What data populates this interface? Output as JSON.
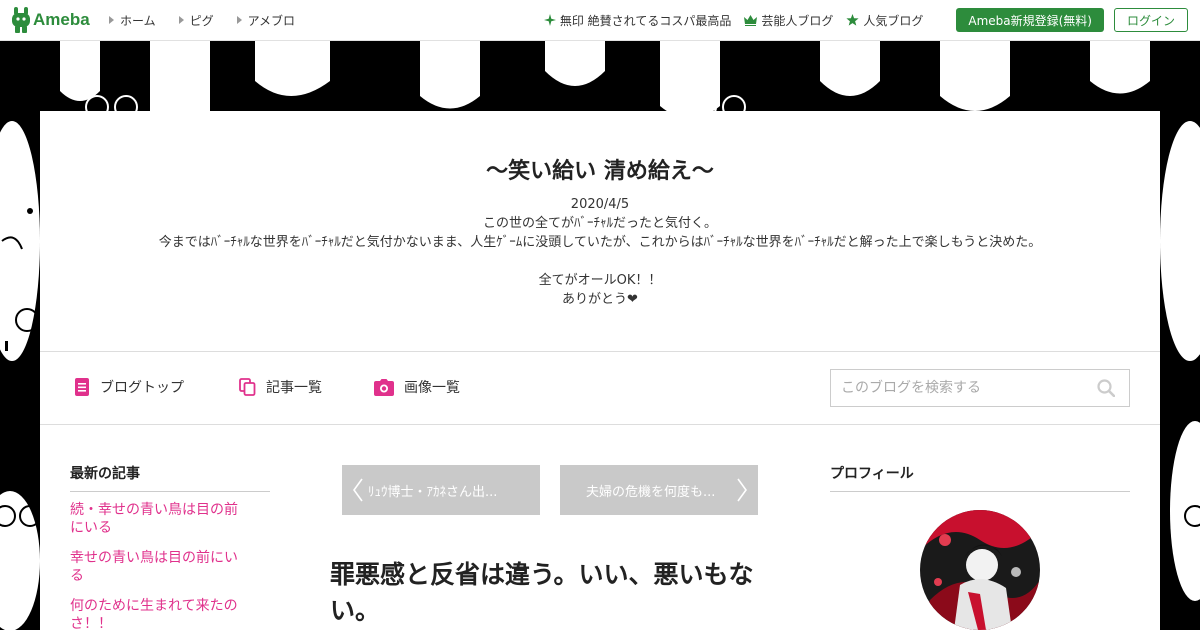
{
  "topbar": {
    "logo_text": "Ameba",
    "nav": [
      {
        "label": "ホーム"
      },
      {
        "label": "ピグ"
      },
      {
        "label": "アメブロ"
      }
    ],
    "promos": [
      {
        "label": "無印 絶賛されてるコスパ最高品",
        "icon": "sparkle-icon"
      },
      {
        "label": "芸能人ブログ",
        "icon": "crown-icon"
      },
      {
        "label": "人気ブログ",
        "icon": "star-icon"
      }
    ],
    "register_label": "Ameba新規登録(無料)",
    "login_label": "ログイン",
    "accent_color": "#2d8c3c"
  },
  "blog": {
    "title": "～笑い給い 清め給え～",
    "description": [
      "2020/4/5",
      "この世の全てがﾊﾞｰﾁｬﾙだったと気付く。",
      "今まではﾊﾞｰﾁｬﾙな世界をﾊﾞｰﾁｬﾙだと気付かないまま、人生ｹﾞｰﾑに没頭していたが、これからはﾊﾞｰﾁｬﾙな世界をﾊﾞｰﾁｬﾙだと解った上で楽しもうと決めた。",
      "",
      "全てがオールOK！！",
      "ありがとう❤"
    ]
  },
  "blognav": {
    "links": [
      {
        "label": "ブログトップ",
        "icon": "document-icon"
      },
      {
        "label": "記事一覧",
        "icon": "copy-icon"
      },
      {
        "label": "画像一覧",
        "icon": "camera-icon"
      }
    ],
    "search_placeholder": "このブログを検索する",
    "link_color": "#e0318c"
  },
  "sidebar": {
    "latest_heading": "最新の記事",
    "latest_items": [
      "続・幸せの青い鳥は目の前にいる",
      "幸せの青い鳥は目の前にいる",
      "何のために生まれて来たのさ！！"
    ]
  },
  "entry": {
    "prev_label": "ﾘｭｳ博士・ｱｶﾈさん出...",
    "next_label": "夫婦の危機を何度も...",
    "title": "罪悪感と反省は違う。いい、悪いもない。"
  },
  "profile": {
    "heading": "プロフィール"
  }
}
